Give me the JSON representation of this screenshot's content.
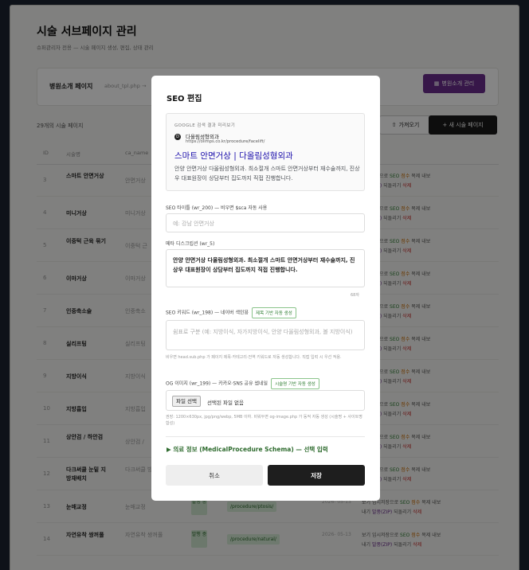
{
  "page": {
    "title": "시술 서브페이지 관리",
    "subtitle": "슈퍼관리자 전용 — 시술 페이지 생성, 편집, 상태 관리",
    "hospital_label": "병원소개 페이지",
    "hospital_file": "about_tpl.php →",
    "hospital_button": "병원소개 관리",
    "count_text": "29개의 시술 페이지",
    "import_button": "가져오기",
    "new_button": "+ 새 시술 페이지"
  },
  "table": {
    "headers": [
      "ID",
      "시술명",
      "ca_name"
    ],
    "action_labels": {
      "view": "보기",
      "temp": "임시저장으로",
      "seo": "SEO",
      "score": "점수",
      "copy": "복제",
      "export": "내보",
      "change": "변경",
      "zip": "발풍(ZIP)",
      "restore": "되돌리기",
      "delete": "삭제",
      "nae": "내기"
    },
    "rows": [
      {
        "id": "3",
        "name": "스마트 안면거상",
        "ca": "안면거상"
      },
      {
        "id": "4",
        "name": "미니거상",
        "ca": "미니거상"
      },
      {
        "id": "5",
        "name": "이중턱 근육 묶기",
        "ca": "이중턱 근"
      },
      {
        "id": "6",
        "name": "이마거상",
        "ca": "이마거상"
      },
      {
        "id": "7",
        "name": "인중축소술",
        "ca": "인중축소"
      },
      {
        "id": "8",
        "name": "실리프팅",
        "ca": "실리프팅"
      },
      {
        "id": "9",
        "name": "지방이식",
        "ca": "지방이식"
      },
      {
        "id": "10",
        "name": "지방흡입",
        "ca": "지방흡입"
      },
      {
        "id": "11",
        "name": "상안검 / 하안검",
        "ca": "상안검 /"
      },
      {
        "id": "12",
        "name": "다크써클 눈밑 지방재배치",
        "ca": "다크써클 방재배치"
      },
      {
        "id": "13",
        "name": "눈매교정",
        "ca": "눈매교정",
        "badge": "발행 중",
        "path": "/procedure/ptosis/",
        "date": "2026- 05-13",
        "act1": "보기",
        "act2": "내기"
      },
      {
        "id": "14",
        "name": "자연유착 쌍꺼풀",
        "ca": "자연유착 쌍꺼풀",
        "badge": "발행 중",
        "path": "/procedure/natural/",
        "date": "2026- 05-13",
        "act1": "보기",
        "act2": "내기"
      }
    ]
  },
  "modal": {
    "title": "SEO 편집",
    "preview_label": "GOOGLE 검색 결과 미리보기",
    "preview_site": "다올림성형외과",
    "preview_url": "https://olimps.co.kr/procedure/facelift/",
    "preview_title": "스마트 안면거상 | 다올림성형외과",
    "preview_desc": "안양 안면거상 다올림성형외과. 최소절개 스마트 안면거상부터 재수술까지, 진상우 대표원장이 상담부터 집도까지 직접 진행합니다.",
    "seo_title_label": "SEO 타이틀 (wr_200) — 비우면 $sca 자동 사용",
    "seo_title_placeholder": "예: 강남 안면거상",
    "meta_label": "메타 디스크립션 (wr_5)",
    "meta_value": "안양 안면거상 다올림성형외과. 최소절개 스마트 안면거상부터 재수술까지, 진상우 대표원장이 상담부터 집도까지 직접 진행합니다.",
    "meta_count": "68자",
    "keyword_label": "SEO 키워드 (wr_198) — 네이버 색인용",
    "keyword_chip": "제목 기반 자동 생성",
    "keyword_placeholder": "쉼표로 구분 (예: 지방이식, 자가지방이식, 안양 다올림성형외과, 볼 지방이식)",
    "keyword_note": "비우면 head.sub.php 가 페이지 제목·카테고리·전역 키워드로 자동 생성합니다. 직접 입력 시 우선 적용.",
    "og_label": "OG 이미지 (wr_199) — 카카오·SNS 공유 썸네일",
    "og_chip": "시술명 기반 자동 생성",
    "file_button": "파일 선택",
    "file_text": "선택된 파일 없음",
    "og_note": "권장: 1200×630px, jpg/png/webp, 5MB 이하. 비워두면 og-image.php 가 동적 자동 생성 (시술명 + 사이트명 합성)",
    "medical_toggle": "▶ 의료 정보 (MedicalProcedure Schema) — 선택 입력",
    "cancel": "취소",
    "save": "저장"
  },
  "colors": {
    "accent_purple": "#6a2c8c",
    "dark_button": "#1e1e1e",
    "link_blue": "#1a0dab",
    "green": "#2e7d32",
    "red": "#c62828"
  }
}
